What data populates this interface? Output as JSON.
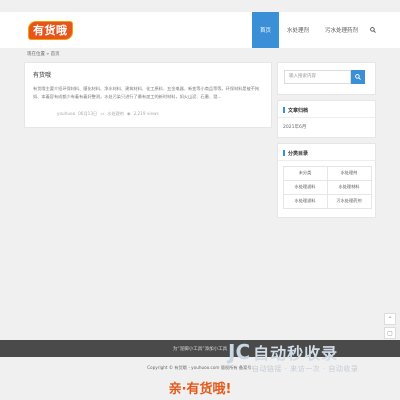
{
  "logo": {
    "text": "有货哦"
  },
  "nav": {
    "items": [
      "首页",
      "水处理剂",
      "污水处理药剂"
    ],
    "active": 0
  },
  "breadcrumb": {
    "text": "现在位置 » 首页"
  },
  "article": {
    "title": "有货哦",
    "body": "有货哦主要介绍环保材料、膜化材料、净水材料、建筑材料、化工原料、五金电器、新变等小商品等等。环保材料是被不拘如、本着容有成都少有着有着好整测，水处污染只进行了最有加工的新时材料，如火山泥、石墨、澄...",
    "author": "youhuoo",
    "date": "06月13日",
    "category": "水处理剂",
    "views": "2,219 views"
  },
  "sidebar": {
    "search_placeholder": "输入搜索内容",
    "archive_title": "文章归档",
    "archive_items": [
      "2021年6月"
    ],
    "categories_title": "分类目录",
    "categories": [
      "未分类",
      "水处理剂",
      "水处理滤料",
      "水处理材料",
      "水处理滤料",
      "污水处理药剂"
    ]
  },
  "footer": {
    "bookmark_text": "为“泥脚小工具”添加小工具",
    "copyright": "Copyright © 有货哦 - youhuoo.com  版权所有 备案号:",
    "slogan": "亲·有货哦!"
  },
  "watermark": {
    "main": "自动秒收录",
    "sub": "自动链接 · 来访一次 · 自动收录"
  },
  "colors": {
    "accent": "#3b8fd6",
    "brand": "#e8541e",
    "slogan": "#e55a1a"
  }
}
